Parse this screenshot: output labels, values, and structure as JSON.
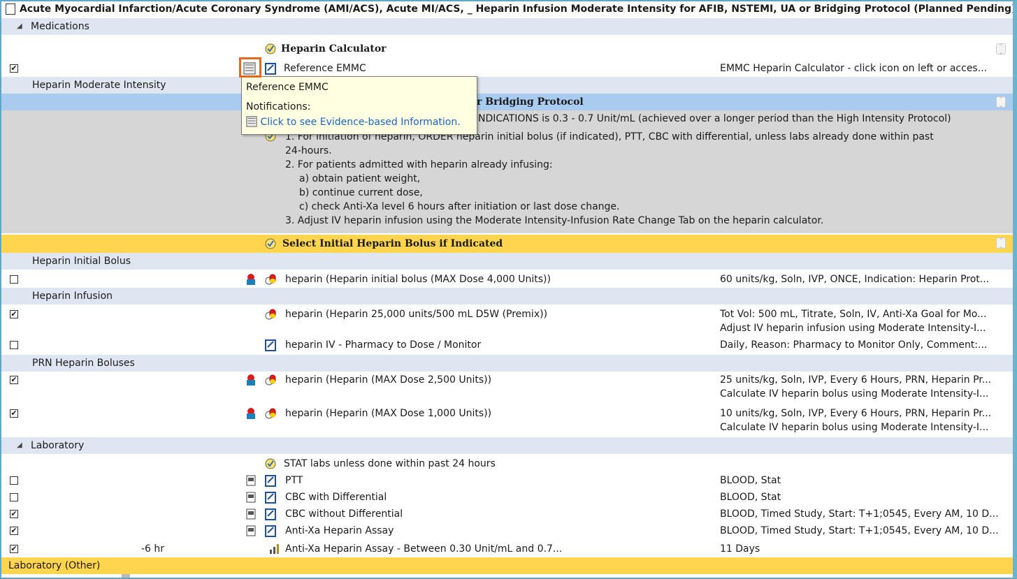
{
  "header": {
    "title": "Acute Myocardial Infarction/Acute Coronary Syndrome (AMI/ACS), Acute MI/ACS, _ Heparin Infusion Moderate Intensity for AFIB, NSTEMI, UA or Bridging Protocol (Planned Pending)"
  },
  "sections": {
    "medications": "Medications",
    "heparin_moderate": "Heparin Moderate Intensity",
    "initial_bolus": "Heparin Initial Bolus",
    "infusion": "Heparin Infusion",
    "prn_boluses": "PRN Heparin Boluses",
    "laboratory": "Laboratory",
    "laboratory_other": "Laboratory (Other)"
  },
  "calculator": {
    "title": "Heparin Calculator",
    "reference": "Reference EMMC",
    "detail": "EMMC Heparin Calculator - click icon on left or acces..."
  },
  "tooltip": {
    "title": "Reference EMMC",
    "notifications": "Notifications:",
    "link": "Click to see Evidence-based Information."
  },
  "protocol": {
    "title_fragment": "r Bridging Protocol",
    "indications": "NDICATIONS is 0.3 - 0.7 Unit/mL (achieved over a longer period than the High Intensity Protocol)",
    "line1a": "1. For initiation of heparin, ORDER heparin initial bolus (if indicated), PTT, CBC with differential, unless labs already done within past",
    "line1b": "24-hours.",
    "line2": "2. For patients admitted with heparin already infusing:",
    "line2a": "a) obtain patient weight,",
    "line2b": "b) continue current dose,",
    "line2c": "c) check Anti-Xa level 6 hours after initiation or last dose change.",
    "line3": "3. Adjust IV heparin infusion using the Moderate Intensity-Infusion Rate Change Tab on the heparin calculator."
  },
  "select_bolus": "Select Initial Heparin Bolus if Indicated",
  "orders": {
    "initial_bolus": {
      "name": "heparin (Heparin initial bolus (MAX Dose 4,000 Units))",
      "detail": "60 units/kg, Soln, IVP, ONCE, Indication: Heparin Prot..."
    },
    "infusion": {
      "name": "heparin (Heparin 25,000 units/500 mL D5W (Premix))",
      "detail1": "Tot Vol: 500 mL, Titrate, Soln, IV, Anti-Xa Goal for Mo...",
      "detail2": "Adjust IV heparin infusion using Moderate Intensity-I..."
    },
    "pharmacy": {
      "name": "heparin IV - Pharmacy to Dose / Monitor",
      "detail": "Daily, Reason: Pharmacy to Monitor Only, Comment:..."
    },
    "prn1": {
      "name": "heparin (Heparin (MAX Dose 2,500 Units))",
      "detail1": "25 units/kg, Soln, IVP, Every 6 Hours, PRN, Heparin Pr...",
      "detail2": "Calculate IV heparin bolus using Moderate Intensity-I..."
    },
    "prn2": {
      "name": "heparin (Heparin (MAX Dose 1,000 Units))",
      "detail1": "10 units/kg, Soln, IVP, Every 6 Hours, PRN, Heparin Pr...",
      "detail2": "Calculate IV heparin bolus using Moderate Intensity-I..."
    }
  },
  "lab": {
    "stat_note": "STAT labs unless done within past 24 hours",
    "ptt": {
      "name": "PTT",
      "detail": "BLOOD, Stat"
    },
    "cbc_diff": {
      "name": "CBC with Differential",
      "detail": "BLOOD, Stat"
    },
    "cbc_nodiff": {
      "name": "CBC without Differential",
      "detail": "BLOOD, Timed Study, Start: T+1;0545, Every AM, 10 D..."
    },
    "antixa": {
      "name": "Anti-Xa Heparin Assay",
      "detail": "BLOOD, Timed Study, Start: T+1;0545, Every AM, 10 D..."
    },
    "antixa_range": {
      "offset": "-6 hr",
      "name": "Anti-Xa Heparin Assay - Between 0.30 Unit/mL and 0.7...",
      "detail": "11 Days"
    }
  },
  "checks": {
    "checked": "✔",
    "unchecked": ""
  }
}
